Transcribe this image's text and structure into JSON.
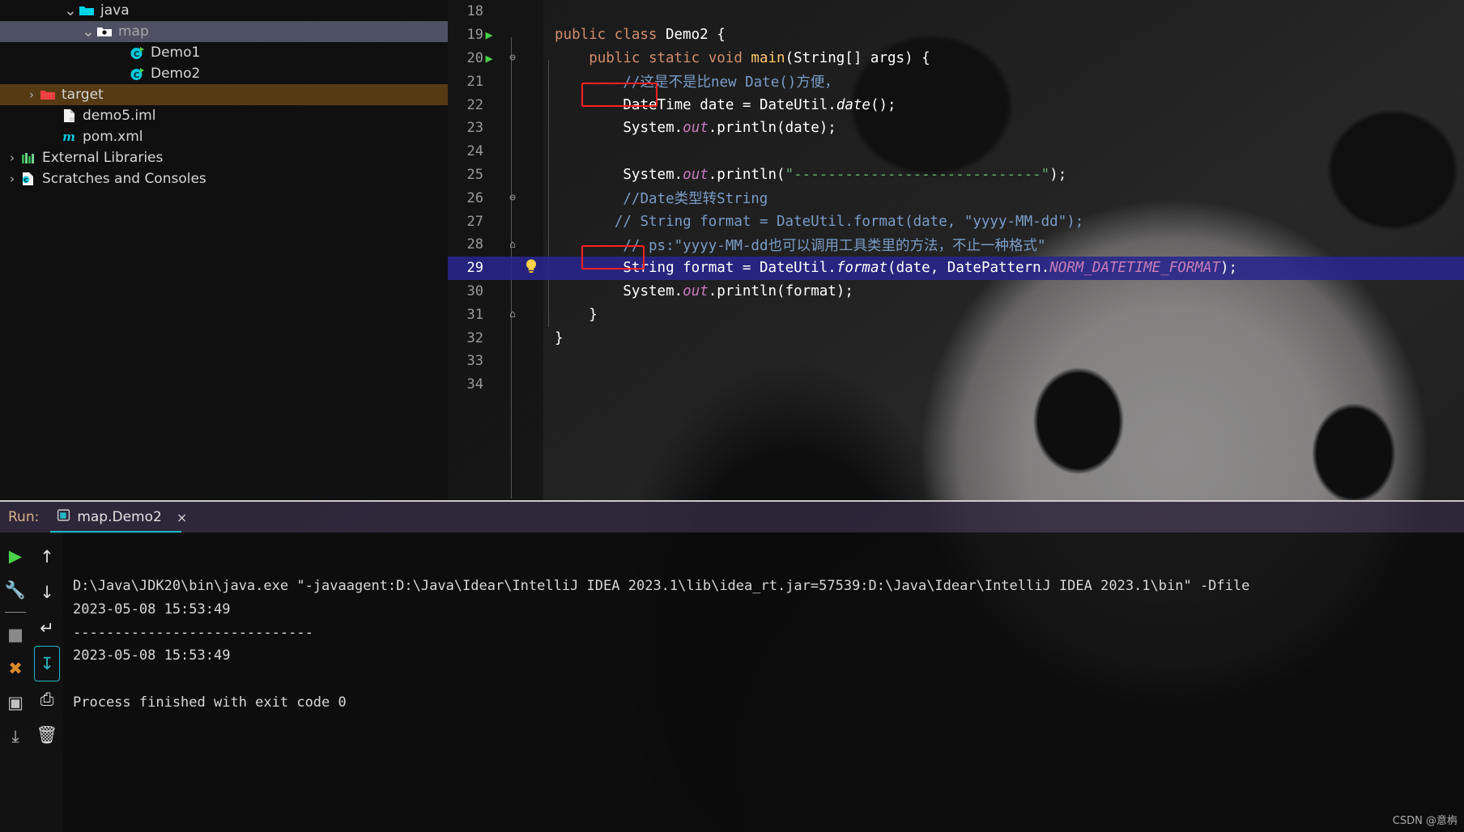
{
  "project_tree": {
    "items": [
      {
        "label": "java",
        "icon": "folder-cyan-icon",
        "chevron": "⌄",
        "indent": 78,
        "state": "normal"
      },
      {
        "label": "map",
        "icon": "folder-package-icon",
        "chevron": "⌄",
        "indent": 100,
        "state": "selected"
      },
      {
        "label": "Demo1",
        "icon": "java-class-run-icon",
        "chevron": "",
        "indent": 140,
        "state": "normal"
      },
      {
        "label": "Demo2",
        "icon": "java-class-run-icon",
        "chevron": "",
        "indent": 140,
        "state": "normal"
      },
      {
        "label": "target",
        "icon": "folder-red-icon",
        "chevron": "›",
        "indent": 30,
        "state": "target"
      },
      {
        "label": "demo5.iml",
        "icon": "iml-file-icon",
        "chevron": "",
        "indent": 56,
        "state": "normal"
      },
      {
        "label": "pom.xml",
        "icon": "maven-pom-icon",
        "chevron": "",
        "indent": 56,
        "state": "normal"
      },
      {
        "label": "External Libraries",
        "icon": "libraries-icon",
        "chevron": "›",
        "indent": 6,
        "state": "normal"
      },
      {
        "label": "Scratches and Consoles",
        "icon": "scratches-icon",
        "chevron": "›",
        "indent": 6,
        "state": "normal"
      }
    ]
  },
  "editor": {
    "lines": [
      {
        "num": "18",
        "gutter": "",
        "fold": "",
        "bulb": "",
        "tokens": []
      },
      {
        "num": "19",
        "gutter": "run",
        "fold": "",
        "bulb": "",
        "indent": 0,
        "tokens": [
          {
            "t": "public ",
            "c": "k"
          },
          {
            "t": "class ",
            "c": "k"
          },
          {
            "t": "Demo2",
            "c": "cls"
          },
          {
            "t": " {",
            "c": "pln"
          }
        ]
      },
      {
        "num": "20",
        "gutter": "run",
        "fold": "⊖",
        "bulb": "",
        "indent": 4,
        "tokens": [
          {
            "t": "public ",
            "c": "k"
          },
          {
            "t": "static ",
            "c": "k"
          },
          {
            "t": "void ",
            "c": "k"
          },
          {
            "t": "main",
            "c": "mth"
          },
          {
            "t": "(",
            "c": "pln"
          },
          {
            "t": "String",
            "c": "cls"
          },
          {
            "t": "[] args) {",
            "c": "pln"
          }
        ]
      },
      {
        "num": "21",
        "gutter": "",
        "fold": "",
        "bulb": "",
        "indent": 8,
        "tokens": [
          {
            "t": "//这是不是比new Date()方便，",
            "c": "cmt"
          }
        ]
      },
      {
        "num": "22",
        "gutter": "",
        "fold": "",
        "bulb": "",
        "indent": 8,
        "tokens": [
          {
            "t": "DateTime",
            "c": "cls"
          },
          {
            "t": " date = ",
            "c": "pln"
          },
          {
            "t": "DateUtil",
            "c": "cls"
          },
          {
            "t": ".",
            "c": "pln"
          },
          {
            "t": "date",
            "c": "mthi"
          },
          {
            "t": "();",
            "c": "pln"
          }
        ]
      },
      {
        "num": "23",
        "gutter": "",
        "fold": "",
        "bulb": "",
        "indent": 8,
        "tokens": [
          {
            "t": "System",
            "c": "cls"
          },
          {
            "t": ".",
            "c": "pln"
          },
          {
            "t": "out",
            "c": "fld"
          },
          {
            "t": ".println(date)",
            "c": "pln"
          },
          {
            "t": ";",
            "c": "pln"
          }
        ]
      },
      {
        "num": "24",
        "gutter": "",
        "fold": "",
        "bulb": "",
        "tokens": []
      },
      {
        "num": "25",
        "gutter": "",
        "fold": "",
        "bulb": "",
        "indent": 8,
        "tokens": [
          {
            "t": "System",
            "c": "cls"
          },
          {
            "t": ".",
            "c": "pln"
          },
          {
            "t": "out",
            "c": "fld"
          },
          {
            "t": ".println(",
            "c": "pln"
          },
          {
            "t": "\"-----------------------------\"",
            "c": "str"
          },
          {
            "t": ");",
            "c": "pln"
          }
        ]
      },
      {
        "num": "26",
        "gutter": "",
        "fold": "⊖",
        "bulb": "",
        "indent": 8,
        "tokens": [
          {
            "t": "//Date类型转String",
            "c": "cmt"
          }
        ]
      },
      {
        "num": "27",
        "gutter": "",
        "fold": "",
        "bulb": "",
        "indent": 7,
        "tokens": [
          {
            "t": "// String format = DateUtil.format(date, \"yyyy-MM-dd\");",
            "c": "cmt"
          }
        ]
      },
      {
        "num": "28",
        "gutter": "",
        "fold": "⌂",
        "bulb": "",
        "indent": 8,
        "tokens": [
          {
            "t": "// ps:\"yyyy-MM-dd也可以调用工具类里的方法，不止一种格式\"",
            "c": "cmt"
          }
        ]
      },
      {
        "num": "29",
        "gutter": "",
        "fold": "",
        "bulb": "bulb",
        "indent": 8,
        "highlight": true,
        "tokens": [
          {
            "t": "String",
            "c": "cls"
          },
          {
            "t": " format = ",
            "c": "pln"
          },
          {
            "t": "DateUtil",
            "c": "cls"
          },
          {
            "t": ".",
            "c": "pln"
          },
          {
            "t": "format",
            "c": "mthi"
          },
          {
            "t": "(date, ",
            "c": "pln"
          },
          {
            "t": "DatePattern",
            "c": "cls"
          },
          {
            "t": ".",
            "c": "pln"
          },
          {
            "t": "NORM_DATETIME_FORMAT",
            "c": "cnst"
          },
          {
            "t": ");",
            "c": "pln"
          }
        ]
      },
      {
        "num": "30",
        "gutter": "",
        "fold": "",
        "bulb": "",
        "indent": 8,
        "tokens": [
          {
            "t": "System",
            "c": "cls"
          },
          {
            "t": ".",
            "c": "pln"
          },
          {
            "t": "out",
            "c": "fld"
          },
          {
            "t": ".println(format);",
            "c": "pln"
          }
        ]
      },
      {
        "num": "31",
        "gutter": "",
        "fold": "⌂",
        "bulb": "",
        "indent": 4,
        "tokens": [
          {
            "t": "}",
            "c": "pln"
          }
        ]
      },
      {
        "num": "32",
        "gutter": "",
        "fold": "",
        "bulb": "",
        "indent": 0,
        "tokens": [
          {
            "t": "}",
            "c": "pln"
          }
        ]
      },
      {
        "num": "33",
        "gutter": "",
        "fold": "",
        "bulb": "",
        "tokens": []
      },
      {
        "num": "34",
        "gutter": "",
        "fold": "",
        "bulb": "",
        "tokens": []
      }
    ]
  },
  "run_window": {
    "label": "Run:",
    "tab_title": "map.Demo2",
    "close_glyph": "×",
    "console_lines": [
      "D:\\Java\\JDK20\\bin\\java.exe \"-javaagent:D:\\Java\\Idear\\IntelliJ IDEA 2023.1\\lib\\idea_rt.jar=57539:D:\\Java\\Idear\\IntelliJ IDEA 2023.1\\bin\" -Dfile",
      "2023-05-08 15:53:49",
      "-----------------------------",
      "2023-05-08 15:53:49",
      "",
      "Process finished with exit code 0"
    ],
    "sidebar_left": [
      {
        "name": "rerun-button",
        "glyph": "▶",
        "color": "#4ad14a"
      },
      {
        "name": "settings-wrench-button",
        "glyph": "🔧",
        "color": "#e0e0e0"
      },
      {
        "name": "stop-button",
        "glyph": "■",
        "color": "#8a8a8a"
      },
      {
        "name": "suppress-button",
        "glyph": "✖",
        "color": "#d88a2a"
      },
      {
        "name": "screenshot-button",
        "glyph": "▣",
        "color": "#c0c0c0"
      },
      {
        "name": "export-button",
        "glyph": "⤓",
        "color": "#c0c0c0"
      }
    ],
    "sidebar_right": [
      {
        "name": "up-arrow-button",
        "glyph": "↑",
        "color": "#e0e0e0"
      },
      {
        "name": "down-arrow-button",
        "glyph": "↓",
        "color": "#e0e0e0"
      },
      {
        "name": "soft-wrap-button",
        "glyph": "↵",
        "color": "#e0e0e0"
      },
      {
        "name": "scroll-to-end-button",
        "glyph": "↧",
        "color": "#22b8c4",
        "active": true
      },
      {
        "name": "print-button",
        "glyph": "⎙",
        "color": "#e0e0e0"
      },
      {
        "name": "clear-all-button",
        "glyph": "🗑",
        "color": "#e0e0e0"
      }
    ]
  },
  "watermark": "CSDN @意栴",
  "colors": {
    "selection_blue": "#282686",
    "tree_selected": "#4e5163",
    "target_brown": "#5c3e14",
    "highlight_red": "#ff2020",
    "accent_cyan": "#22b8c4",
    "run_label": "#d6b48a"
  }
}
